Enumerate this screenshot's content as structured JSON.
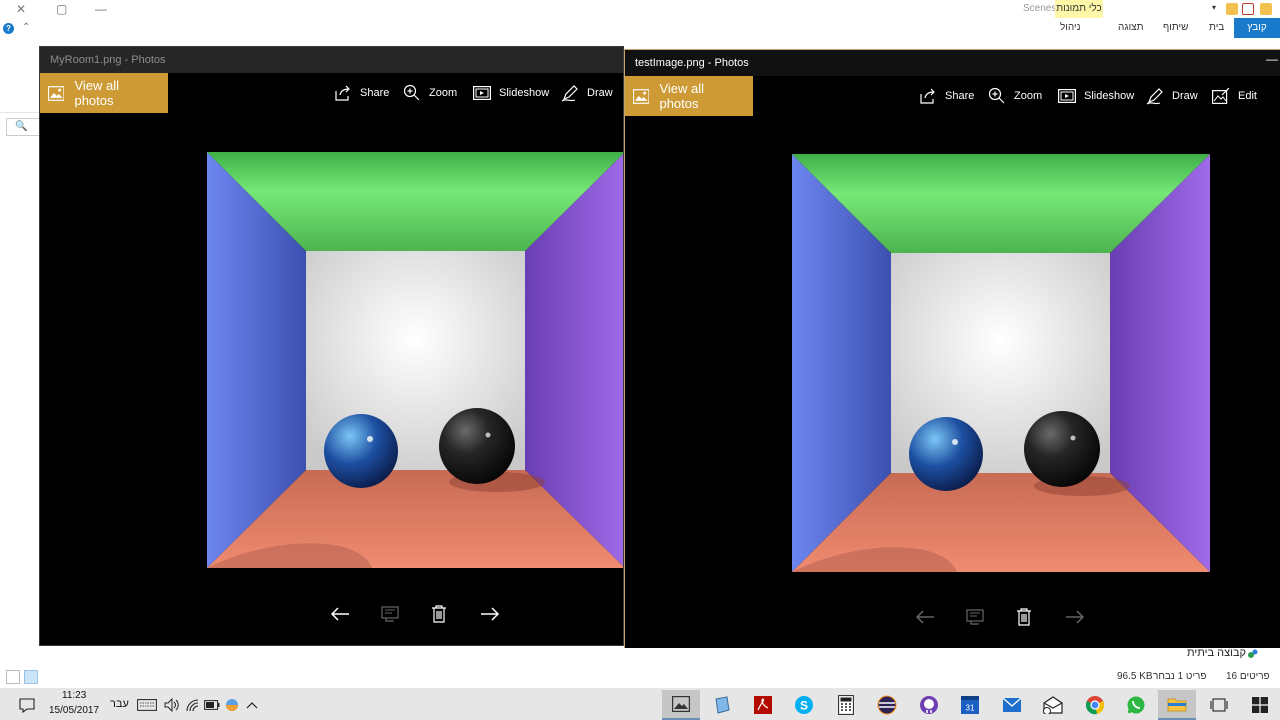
{
  "explorer": {
    "title_fragment": "Scenes",
    "tools_label": "כלי תמונות",
    "manage_label": "ניהול",
    "ribbon_tabs": [
      "קובץ",
      "בית",
      "שיתוף",
      "תצוגה"
    ],
    "homegroup": "קבוצה ביתית",
    "status": {
      "items_count": "16 פריטים",
      "selected": "פריט 1 נבחר",
      "size": "96.5 KB"
    }
  },
  "left_window": {
    "title": "MyRoom1.png - Photos",
    "view_all": "View all photos",
    "tools": [
      "Share",
      "Zoom",
      "Slideshow",
      "Draw"
    ]
  },
  "right_window": {
    "title": "testImage.png - Photos",
    "view_all": "View all photos",
    "tools": [
      "Share",
      "Zoom",
      "Slideshow",
      "Draw",
      "Edit"
    ]
  },
  "taskbar": {
    "time": "11:23",
    "date": "15/05/2017",
    "language": "עבר",
    "apps": [
      "photos",
      "notepad",
      "acrobat",
      "skype",
      "calculator",
      "eclipse",
      "github",
      "calendar",
      "mail",
      "outlook",
      "chrome",
      "whatsapp",
      "file-explorer",
      "task-view",
      "start"
    ]
  },
  "colors": {
    "accent": "#cd9a35",
    "room_ceiling": "#5fd664",
    "room_left_wall": "#5a72e0",
    "room_right_wall": "#8a55d6",
    "room_floor": "#e17d62",
    "room_back": "#f2f2f2"
  }
}
